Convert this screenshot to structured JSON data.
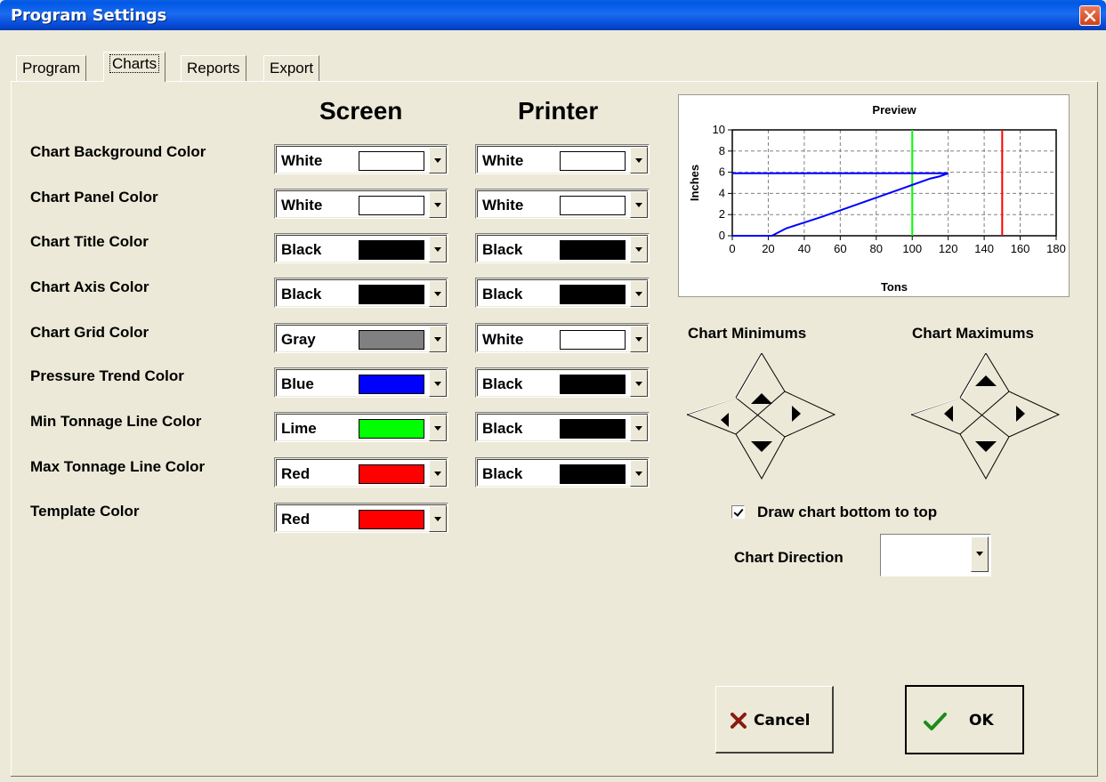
{
  "window": {
    "title": "Program Settings"
  },
  "tabs": [
    {
      "label": "Program",
      "active": false
    },
    {
      "label": "Charts",
      "active": true
    },
    {
      "label": "Reports",
      "active": false
    },
    {
      "label": "Export",
      "active": false
    }
  ],
  "columns": {
    "screen": "Screen",
    "printer": "Printer"
  },
  "rows": [
    {
      "label": "Chart Background Color",
      "screen": {
        "name": "White",
        "color": "#ffffff"
      },
      "printer": {
        "name": "White",
        "color": "#ffffff"
      }
    },
    {
      "label": "Chart Panel Color",
      "screen": {
        "name": "White",
        "color": "#ffffff"
      },
      "printer": {
        "name": "White",
        "color": "#ffffff"
      }
    },
    {
      "label": "Chart Title Color",
      "screen": {
        "name": "Black",
        "color": "#000000"
      },
      "printer": {
        "name": "Black",
        "color": "#000000"
      }
    },
    {
      "label": "Chart Axis Color",
      "screen": {
        "name": "Black",
        "color": "#000000"
      },
      "printer": {
        "name": "Black",
        "color": "#000000"
      }
    },
    {
      "label": "Chart Grid Color",
      "screen": {
        "name": "Gray",
        "color": "#808080"
      },
      "printer": {
        "name": "White",
        "color": "#ffffff"
      }
    },
    {
      "label": "Pressure Trend Color",
      "screen": {
        "name": "Blue",
        "color": "#0000ff"
      },
      "printer": {
        "name": "Black",
        "color": "#000000"
      }
    },
    {
      "label": "Min Tonnage Line Color",
      "screen": {
        "name": "Lime",
        "color": "#00ff00"
      },
      "printer": {
        "name": "Black",
        "color": "#000000"
      }
    },
    {
      "label": "Max Tonnage Line Color",
      "screen": {
        "name": "Red",
        "color": "#ff0000"
      },
      "printer": {
        "name": "Black",
        "color": "#000000"
      }
    },
    {
      "label": "Template Color",
      "screen": {
        "name": "Red",
        "color": "#ff0000"
      },
      "printer": null
    }
  ],
  "preview": {
    "chart_data": {
      "type": "line",
      "title": "Preview",
      "xlabel": "Tons",
      "ylabel": "Inches",
      "xlim": [
        0,
        180
      ],
      "ylim": [
        0,
        10
      ],
      "xticks": [
        0,
        20,
        40,
        60,
        80,
        100,
        120,
        140,
        160,
        180
      ],
      "yticks": [
        0,
        2,
        4,
        6,
        8,
        10
      ],
      "grid": true,
      "series": [
        {
          "color": "#0000ff",
          "x": [
            0,
            22,
            30,
            50,
            70,
            90,
            100,
            110,
            115,
            120,
            0
          ],
          "y": [
            0,
            0,
            0.7,
            1.8,
            3.0,
            4.2,
            4.8,
            5.4,
            5.6,
            5.9,
            5.9
          ]
        }
      ],
      "vlines": [
        {
          "x": 100,
          "color": "#00ff00"
        },
        {
          "x": 150,
          "color": "#ff0000"
        }
      ]
    }
  },
  "chart_minimums": {
    "label": "Chart Minimums"
  },
  "chart_maximums": {
    "label": "Chart Maximums"
  },
  "draw_bottom_to_top": {
    "label": "Draw chart bottom to top",
    "checked": true
  },
  "chart_direction": {
    "label": "Chart Direction",
    "value": ""
  },
  "buttons": {
    "cancel": "Cancel",
    "ok": "OK"
  }
}
